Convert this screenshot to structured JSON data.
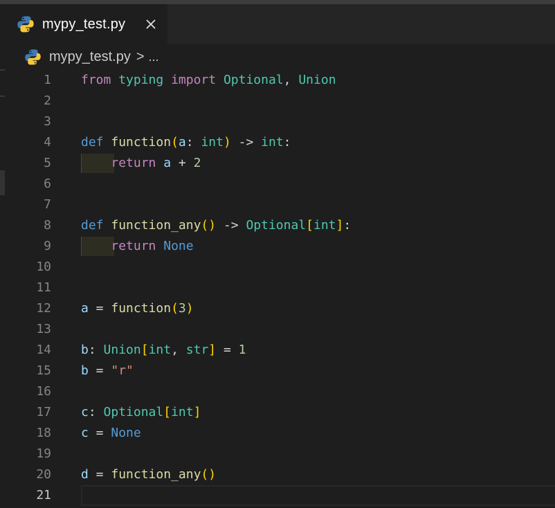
{
  "tab": {
    "title": "mypy_test.py",
    "icon": "python-icon",
    "close_icon": "close-icon"
  },
  "breadcrumb": {
    "file": "mypy_test.py",
    "separator": ">",
    "more": "..."
  },
  "editor": {
    "active_line": 21,
    "lines": [
      {
        "n": "1",
        "tokens": [
          [
            "kw",
            "from"
          ],
          [
            "op",
            " "
          ],
          [
            "typ",
            "typing"
          ],
          [
            "op",
            " "
          ],
          [
            "kw",
            "import"
          ],
          [
            "op",
            " "
          ],
          [
            "typ",
            "Optional"
          ],
          [
            "op",
            ", "
          ],
          [
            "typ",
            "Union"
          ]
        ]
      },
      {
        "n": "2",
        "tokens": []
      },
      {
        "n": "3",
        "tokens": []
      },
      {
        "n": "4",
        "tokens": [
          [
            "def",
            "def"
          ],
          [
            "op",
            " "
          ],
          [
            "fn",
            "function"
          ],
          [
            "br",
            "("
          ],
          [
            "var",
            "a"
          ],
          [
            "op",
            ": "
          ],
          [
            "typ",
            "int"
          ],
          [
            "br",
            ")"
          ],
          [
            "op",
            " -> "
          ],
          [
            "typ",
            "int"
          ],
          [
            "op",
            ":"
          ]
        ]
      },
      {
        "n": "5",
        "indent": true,
        "tokens": [
          [
            "op",
            "    "
          ],
          [
            "kw",
            "return"
          ],
          [
            "op",
            " "
          ],
          [
            "var",
            "a"
          ],
          [
            "op",
            " + "
          ],
          [
            "num",
            "2"
          ]
        ]
      },
      {
        "n": "6",
        "tokens": []
      },
      {
        "n": "7",
        "tokens": []
      },
      {
        "n": "8",
        "tokens": [
          [
            "def",
            "def"
          ],
          [
            "op",
            " "
          ],
          [
            "fn",
            "function_any"
          ],
          [
            "br",
            "()"
          ],
          [
            "op",
            " -> "
          ],
          [
            "typ",
            "Optional"
          ],
          [
            "br",
            "["
          ],
          [
            "typ",
            "int"
          ],
          [
            "br",
            "]"
          ],
          [
            "op",
            ":"
          ]
        ]
      },
      {
        "n": "9",
        "indent": true,
        "tokens": [
          [
            "op",
            "    "
          ],
          [
            "kw",
            "return"
          ],
          [
            "op",
            " "
          ],
          [
            "cst",
            "None"
          ]
        ]
      },
      {
        "n": "10",
        "tokens": []
      },
      {
        "n": "11",
        "tokens": []
      },
      {
        "n": "12",
        "tokens": [
          [
            "var",
            "a"
          ],
          [
            "op",
            " = "
          ],
          [
            "fn",
            "function"
          ],
          [
            "br",
            "("
          ],
          [
            "num",
            "3"
          ],
          [
            "br",
            ")"
          ]
        ]
      },
      {
        "n": "13",
        "tokens": []
      },
      {
        "n": "14",
        "tokens": [
          [
            "var",
            "b"
          ],
          [
            "op",
            ": "
          ],
          [
            "typ",
            "Union"
          ],
          [
            "br",
            "["
          ],
          [
            "typ",
            "int"
          ],
          [
            "op",
            ", "
          ],
          [
            "typ",
            "str"
          ],
          [
            "br",
            "]"
          ],
          [
            "op",
            " = "
          ],
          [
            "num",
            "1"
          ]
        ]
      },
      {
        "n": "15",
        "tokens": [
          [
            "var",
            "b"
          ],
          [
            "op",
            " = "
          ],
          [
            "str",
            "\"r\""
          ]
        ]
      },
      {
        "n": "16",
        "tokens": []
      },
      {
        "n": "17",
        "tokens": [
          [
            "var",
            "c"
          ],
          [
            "op",
            ": "
          ],
          [
            "typ",
            "Optional"
          ],
          [
            "br",
            "["
          ],
          [
            "typ",
            "int"
          ],
          [
            "br",
            "]"
          ]
        ]
      },
      {
        "n": "18",
        "tokens": [
          [
            "var",
            "c"
          ],
          [
            "op",
            " = "
          ],
          [
            "cst",
            "None"
          ]
        ]
      },
      {
        "n": "19",
        "tokens": []
      },
      {
        "n": "20",
        "tokens": [
          [
            "var",
            "d"
          ],
          [
            "op",
            " = "
          ],
          [
            "fn",
            "function_any"
          ],
          [
            "br",
            "()"
          ]
        ]
      },
      {
        "n": "21",
        "tokens": []
      }
    ]
  },
  "colors": {
    "editor_bg": "#1e1e1e",
    "tabbar_bg": "#252526",
    "keyword": "#c586c0",
    "def": "#569cd6",
    "function": "#dcdcaa",
    "variable": "#9cdcfe",
    "type": "#4ec9b0",
    "number": "#b5cea8",
    "string": "#ce9178",
    "bracket": "#ffd700"
  }
}
